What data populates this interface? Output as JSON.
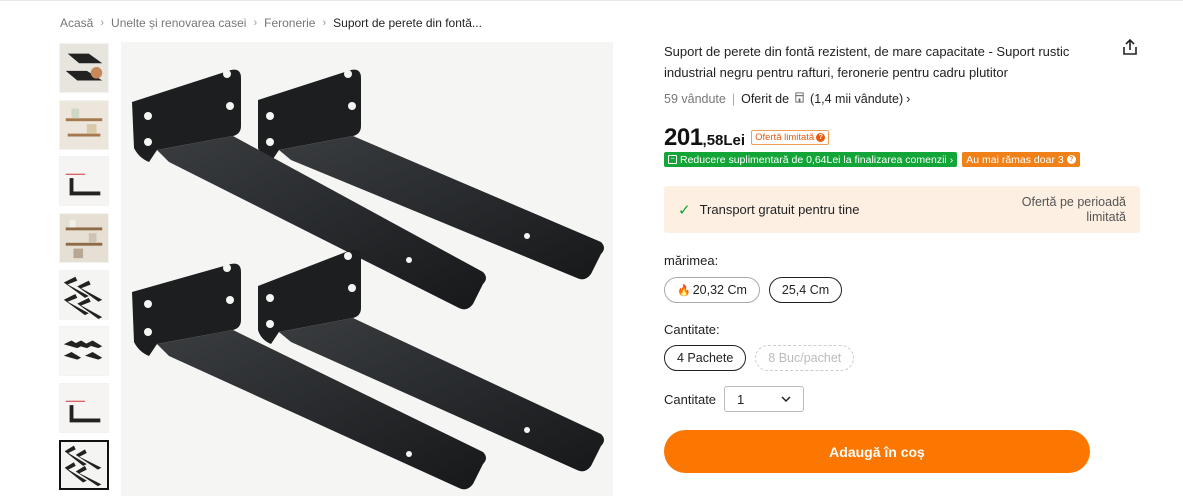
{
  "breadcrumb": {
    "items": [
      "Acasă",
      "Unelte și renovarea casei",
      "Feronerie"
    ],
    "current": "Suport de perete din fontă..."
  },
  "thumbnails": {
    "count": 8,
    "active_index": 7
  },
  "product": {
    "title": "Suport de perete din fontă rezistent, de mare capacitate - Suport rustic industrial negru pentru rafturi, feronerie pentru cadru plutitor",
    "sold": "59 vândute",
    "offered_by": "Oferit de",
    "store_sold": "(1,4 mii vândute)"
  },
  "price": {
    "integer": "201",
    "decimal": ",58Lei",
    "badge": "Ofertă limitată"
  },
  "promos": {
    "discount": "Reducere suplimentară de 0,64Lei la finalizarea comenzii",
    "stock": "Au mai rămas doar 3"
  },
  "shipping": {
    "free": "Transport gratuit pentru tine",
    "limited": "Ofertă pe perioadă limitată"
  },
  "size": {
    "label": "mărimea:",
    "options": [
      "20,32 Cm",
      "25,4 Cm"
    ]
  },
  "pack": {
    "label": "Cantitate:",
    "options": [
      "4 Pachete",
      "8 Buc/pachet"
    ]
  },
  "quantity": {
    "label": "Cantitate",
    "value": "1"
  },
  "cart": {
    "button": "Adaugă în coș"
  },
  "colors": {
    "accent": "#fb7701",
    "green": "#13a538",
    "shipping_bg": "#fdefe2"
  },
  "icons": [
    "share-icon",
    "store-icon",
    "check-icon",
    "flame-icon",
    "chevron-down-icon",
    "question-icon"
  ]
}
